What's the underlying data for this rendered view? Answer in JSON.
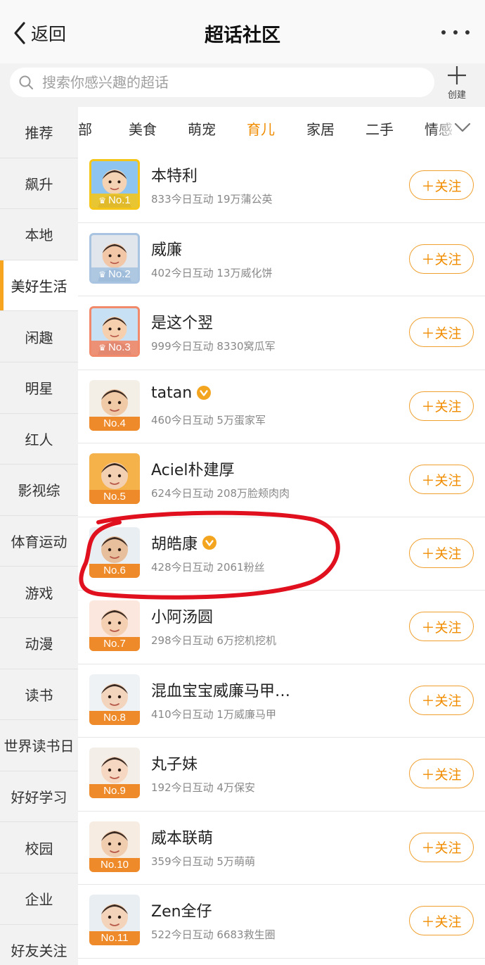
{
  "header": {
    "back_label": "返回",
    "title": "超话社区"
  },
  "search": {
    "placeholder": "搜索你感兴趣的超话",
    "create_label": "创建"
  },
  "sidebar": {
    "items": [
      {
        "label": "推荐"
      },
      {
        "label": "飙升"
      },
      {
        "label": "本地"
      },
      {
        "label": "美好生活",
        "active": true
      },
      {
        "label": "闲趣"
      },
      {
        "label": "明星"
      },
      {
        "label": "红人"
      },
      {
        "label": "影视综"
      },
      {
        "label": "体育运动"
      },
      {
        "label": "游戏"
      },
      {
        "label": "动漫"
      },
      {
        "label": "读书"
      },
      {
        "label": "世界读书日"
      },
      {
        "label": "好好学习"
      },
      {
        "label": "校园"
      },
      {
        "label": "企业"
      },
      {
        "label": "好友关注"
      }
    ]
  },
  "tabs": {
    "items": [
      {
        "label": "部"
      },
      {
        "label": "美食"
      },
      {
        "label": "萌宠"
      },
      {
        "label": "育儿",
        "active": true
      },
      {
        "label": "家居"
      },
      {
        "label": "二手"
      },
      {
        "label": "情感"
      }
    ]
  },
  "list": {
    "follow_label": "＋关注",
    "items": [
      {
        "rank": "No.1",
        "name": "本特利",
        "stats": "833今日互动 19万蒲公英",
        "verified": false
      },
      {
        "rank": "No.2",
        "name": "威廉",
        "stats": "402今日互动 13万威化饼",
        "verified": false
      },
      {
        "rank": "No.3",
        "name": "是这个翌",
        "stats": "999今日互动 8330窝瓜军",
        "verified": false
      },
      {
        "rank": "No.4",
        "name": "tatan",
        "stats": "460今日互动 5万蛋家军",
        "verified": true
      },
      {
        "rank": "No.5",
        "name": "Aciel朴建厚",
        "stats": "624今日互动 208万脸颊肉肉",
        "verified": false
      },
      {
        "rank": "No.6",
        "name": "胡皓康",
        "stats": "428今日互动 2061粉丝",
        "verified": true
      },
      {
        "rank": "No.7",
        "name": "小阿汤圆",
        "stats": "298今日互动 6万挖机挖机",
        "verified": false
      },
      {
        "rank": "No.8",
        "name": "混血宝宝威廉马甲…",
        "stats": "410今日互动 1万威廉马甲",
        "verified": false
      },
      {
        "rank": "No.9",
        "name": "丸子妹",
        "stats": "192今日互动 4万保安",
        "verified": false
      },
      {
        "rank": "No.10",
        "name": "威本联萌",
        "stats": "359今日互动 5万萌萌",
        "verified": false
      },
      {
        "rank": "No.11",
        "name": "Zen全仔",
        "stats": "522今日互动 6683救生圈",
        "verified": false
      }
    ]
  },
  "colors": {
    "accent": "#f08c00",
    "gold": "#f5c518",
    "silver": "#a8c4e0",
    "bronze": "#f08a6a",
    "rank_orange": "#ee8a2a",
    "highlight_red": "#e0101e"
  }
}
